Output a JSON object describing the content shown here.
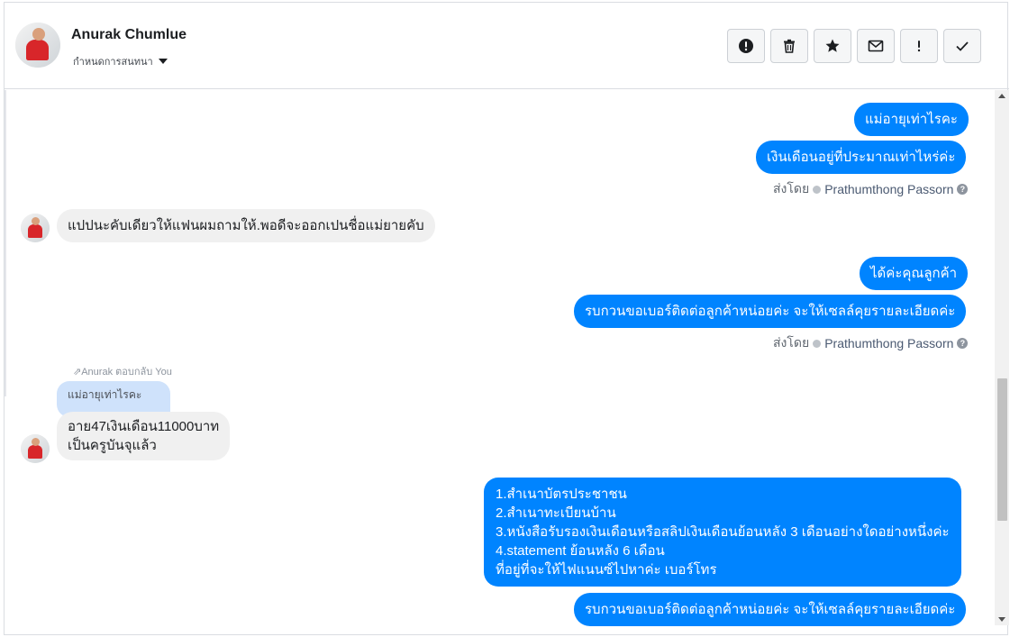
{
  "header": {
    "contact_name": "Anurak Chumlue",
    "conversation_label": "กำหนดการสนทนา"
  },
  "toolbar": [
    {
      "name": "alert-icon",
      "label": "Mark as spam"
    },
    {
      "name": "trash-icon",
      "label": "Delete"
    },
    {
      "name": "star-icon",
      "label": "Star"
    },
    {
      "name": "envelope-icon",
      "label": "Mark as unread"
    },
    {
      "name": "exclamation-icon",
      "label": "Follow up"
    },
    {
      "name": "check-icon",
      "label": "Done"
    }
  ],
  "messages": {
    "m1": "แม่อายุเท่าไรคะ",
    "m2": "เงินเดือนอยู่ที่ประมาณเท่าไหร่ค่ะ",
    "m3": "แปปนะคับเดียวให้แฟนผมถามให้.พอดีจะออกเปนชื่อแม่ยายคับ",
    "m4": "ได้ค่ะคุณลูกค้า",
    "m5": "รบกวนขอเบอร์ติดต่อลูกค้าหน่อยค่ะ จะให้เซลล์คุยรายละเอียดค่ะ",
    "reply_note": "Anurak ตอบกลับ You",
    "quoted": "แม่อายุเท่าไรคะ",
    "m6_line1": "อาย47เงินเดือน11000บาท",
    "m6_line2": "เป็นครูบันจุแล้ว",
    "m7_line1": "1.สำเนาบัตรประชาชน",
    "m7_line2": "2.สำเนาทะเบียนบ้าน",
    "m7_line3": "3.หนังสือรับรองเงินเดือนหรือสลิปเงินเดือนย้อนหลัง 3 เดือนอย่างใดอย่างหนึ่งค่ะ",
    "m7_line4": "4.statement ย้อนหลัง 6 เดือน",
    "m7_line5": "ที่อยู่ที่จะให้ไฟแนนซ์ไปหาค่ะ เบอร์โทร",
    "m8": "รบกวนขอเบอร์ติดต่อลูกค้าหน่อยค่ะ จะให้เซลล์คุยรายละเอียดค่ะ"
  },
  "sent_by": {
    "prefix": "ส่งโดย",
    "agent": "Prathumthong Passorn",
    "help": "?"
  },
  "colors": {
    "outgoing": "#0084ff",
    "incoming": "#f0f0f0",
    "quoted": "#cfe2fb"
  }
}
